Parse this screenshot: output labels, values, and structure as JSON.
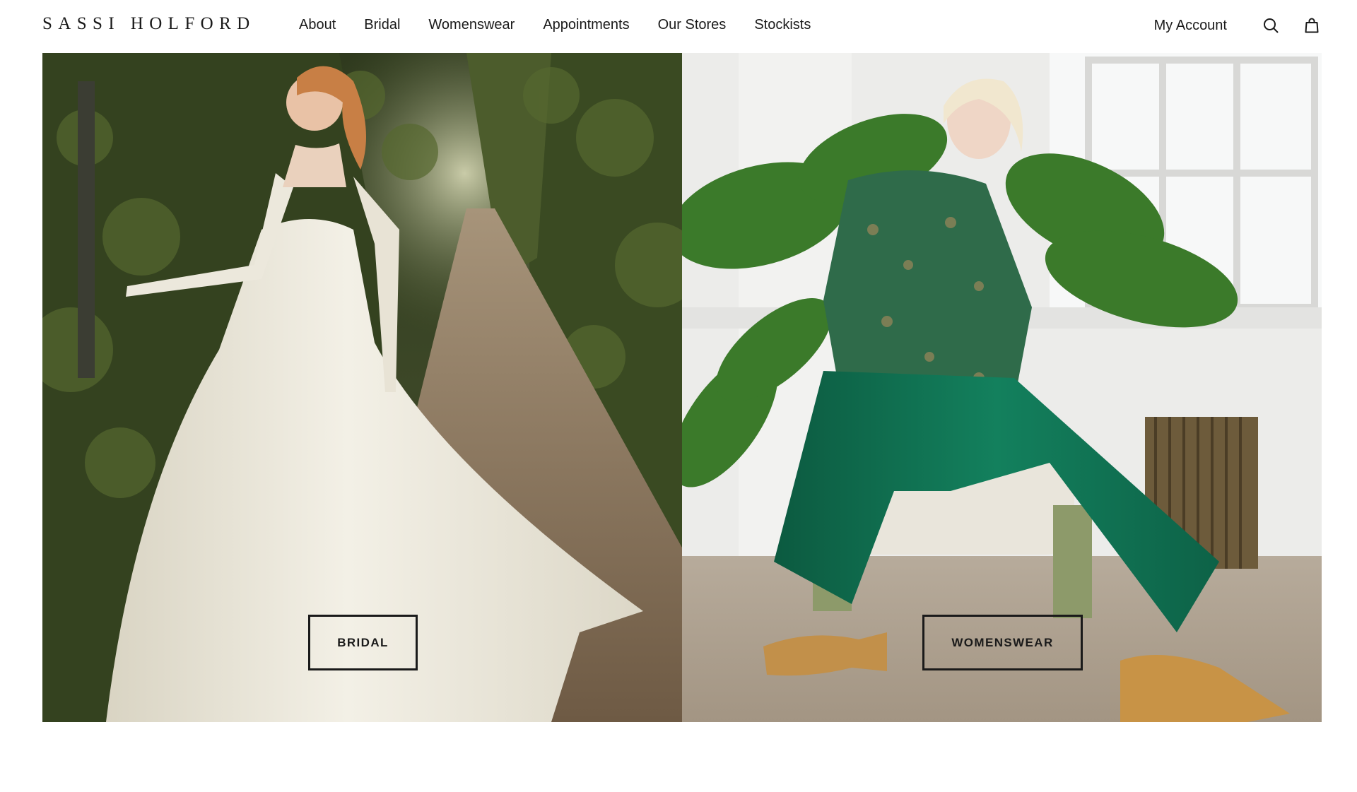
{
  "header": {
    "logo": "SASSI HOLFORD",
    "nav": [
      "About",
      "Bridal",
      "Womenswear",
      "Appointments",
      "Our Stores",
      "Stockists"
    ],
    "account_label": "My Account",
    "icons": [
      "search-icon",
      "bag-icon"
    ]
  },
  "panels": [
    {
      "id": "bridal",
      "cta_label": "BRIDAL",
      "image_alt": ""
    },
    {
      "id": "womenswear",
      "cta_label": "WOMENSWEAR",
      "image_alt": ""
    }
  ],
  "colors": {
    "text": "#1a1a1a",
    "background": "#ffffff",
    "garden_green": "#3f4a2a",
    "path_brown": "#8a7258",
    "gown_ivory": "#ece8dc",
    "suit_green": "#0f6b4e",
    "wall_white": "#ececea"
  }
}
